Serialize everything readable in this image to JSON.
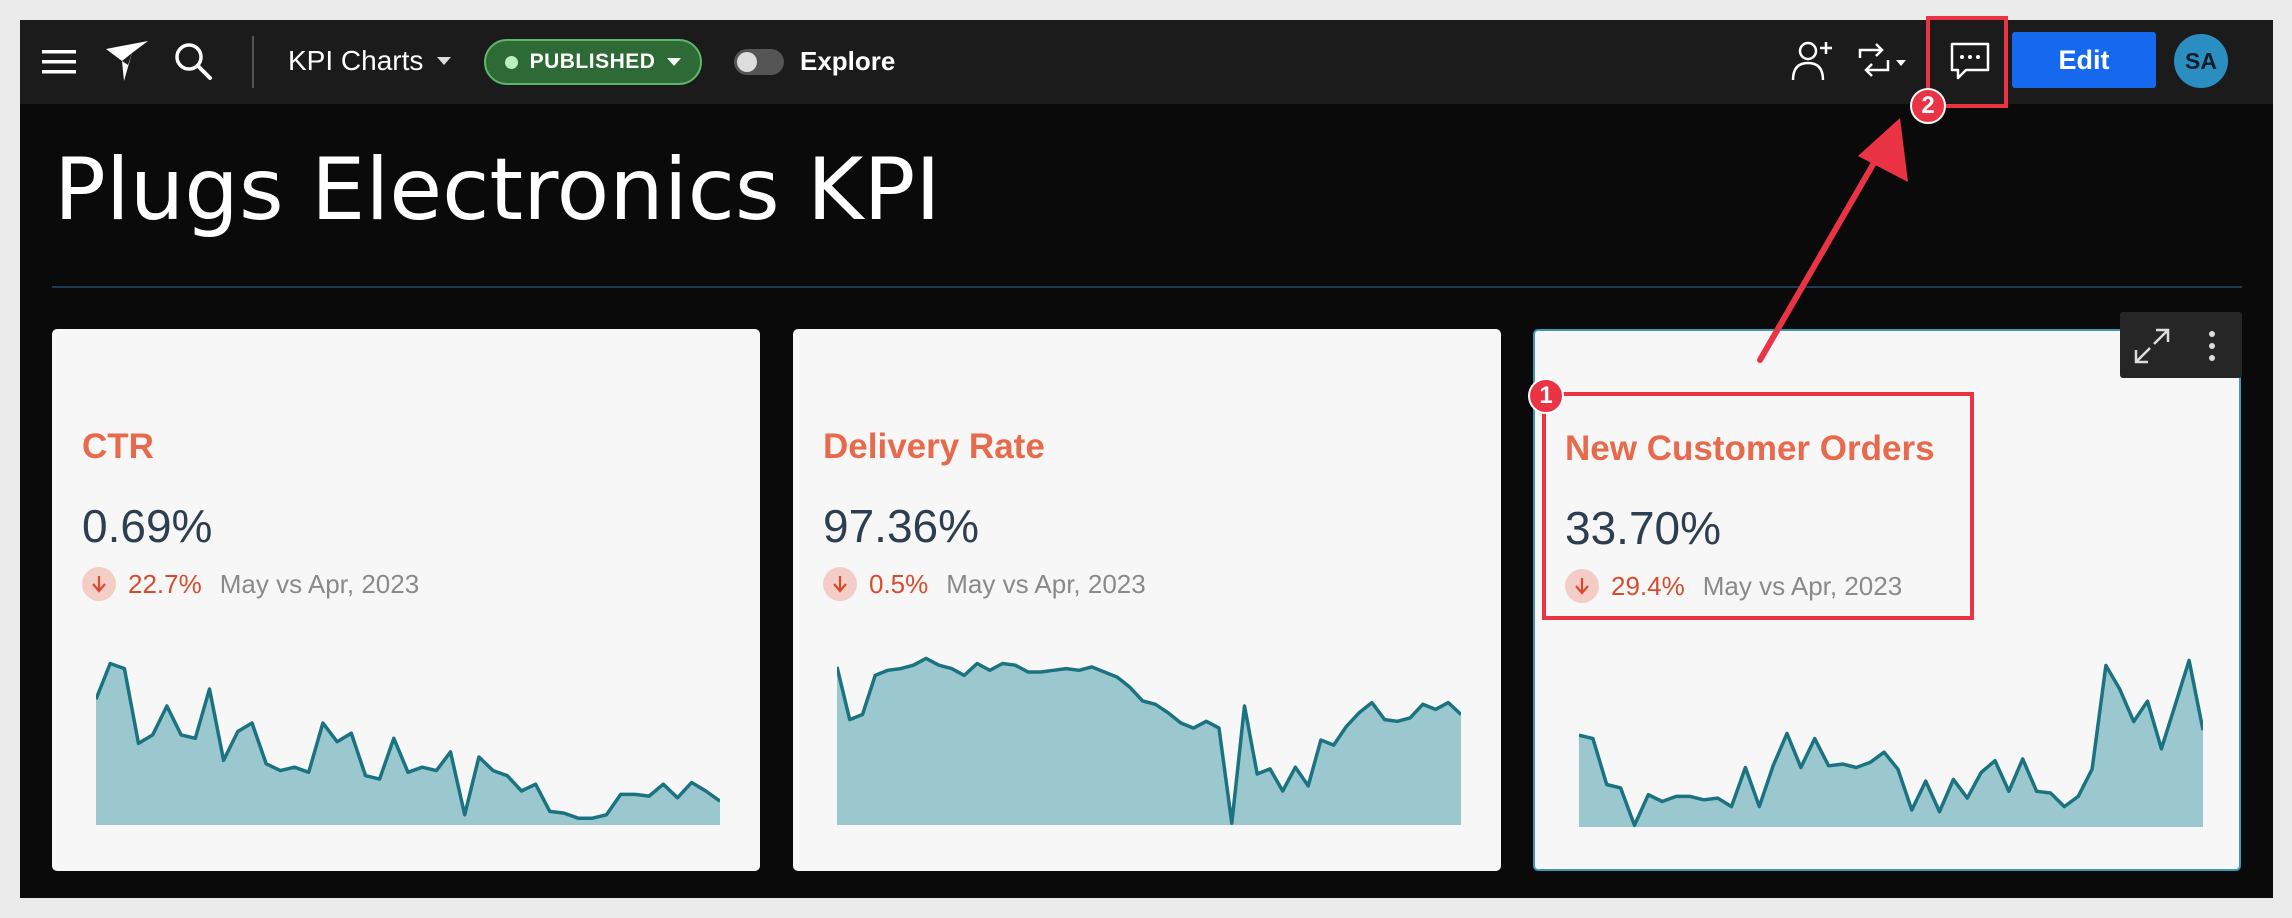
{
  "header": {
    "doc_title": "KPI Charts",
    "status": "PUBLISHED",
    "explore_label": "Explore",
    "edit_label": "Edit",
    "avatar_initials": "SA"
  },
  "page": {
    "title": "Plugs Electronics KPI"
  },
  "cards": [
    {
      "title": "CTR",
      "value": "0.69%",
      "change": "22.7%",
      "period": "May vs Apr, 2023",
      "trend": "down",
      "spark": [
        0.74,
        0.95,
        0.92,
        0.48,
        0.53,
        0.7,
        0.53,
        0.51,
        0.8,
        0.38,
        0.55,
        0.6,
        0.36,
        0.32,
        0.34,
        0.31,
        0.6,
        0.49,
        0.54,
        0.29,
        0.27,
        0.51,
        0.31,
        0.34,
        0.32,
        0.43,
        0.06,
        0.4,
        0.32,
        0.29,
        0.2,
        0.24,
        0.08,
        0.07,
        0.04,
        0.04,
        0.06,
        0.18,
        0.18,
        0.17,
        0.24,
        0.16,
        0.25,
        0.2,
        0.14
      ]
    },
    {
      "title": "Delivery Rate",
      "value": "97.36%",
      "change": "0.5%",
      "period": "May vs Apr, 2023",
      "trend": "down",
      "spark": [
        0.93,
        0.62,
        0.65,
        0.88,
        0.91,
        0.92,
        0.94,
        0.98,
        0.94,
        0.92,
        0.88,
        0.95,
        0.91,
        0.95,
        0.94,
        0.9,
        0.9,
        0.91,
        0.92,
        0.91,
        0.93,
        0.9,
        0.87,
        0.81,
        0.73,
        0.71,
        0.66,
        0.6,
        0.57,
        0.61,
        0.57,
        0.01,
        0.7,
        0.3,
        0.33,
        0.2,
        0.34,
        0.23,
        0.5,
        0.47,
        0.58,
        0.66,
        0.72,
        0.62,
        0.61,
        0.63,
        0.71,
        0.68,
        0.72,
        0.65
      ]
    },
    {
      "title": "New Customer Orders",
      "value": "33.70%",
      "change": "29.4%",
      "period": "May vs Apr, 2023",
      "trend": "down",
      "spark": [
        0.54,
        0.52,
        0.25,
        0.23,
        0.01,
        0.19,
        0.15,
        0.18,
        0.18,
        0.16,
        0.17,
        0.12,
        0.35,
        0.12,
        0.36,
        0.55,
        0.35,
        0.52,
        0.36,
        0.37,
        0.35,
        0.38,
        0.44,
        0.34,
        0.1,
        0.27,
        0.09,
        0.28,
        0.17,
        0.32,
        0.39,
        0.21,
        0.4,
        0.21,
        0.2,
        0.12,
        0.18,
        0.34,
        0.95,
        0.81,
        0.62,
        0.74,
        0.46,
        0.72,
        0.98,
        0.57
      ]
    }
  ],
  "colors": {
    "accent": "#1469ef",
    "published": "#2d6a36",
    "spark_line": "#1b7382",
    "spark_fill": "#9bc8ce",
    "annotation": "#ea3446",
    "kpi_title": "#e86a4c"
  },
  "annotations": [
    "1",
    "2"
  ]
}
